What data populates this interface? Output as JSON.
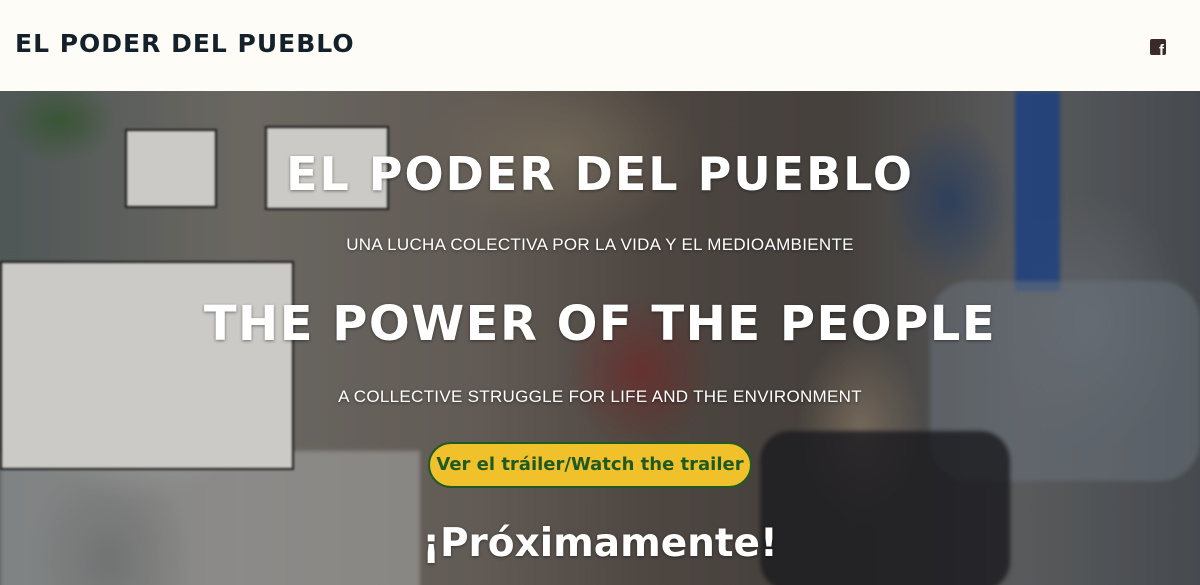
{
  "header": {
    "site_title": "EL PODER DEL PUEBLO",
    "social_icon": "facebook-icon",
    "social_glyph": "f"
  },
  "hero": {
    "title_es": "EL PODER DEL PUEBLO",
    "subtitle_es": "UNA LUCHA COLECTIVA POR LA VIDA Y EL MEDIOAMBIENTE",
    "title_en": "THE POWER OF THE PEOPLE",
    "subtitle_en": "A COLLECTIVE STRUGGLE FOR LIFE AND THE ENVIRONMENT",
    "cta_label": "Ver el tráiler/Watch the trailer",
    "coming_soon": "¡Próximamente!"
  },
  "colors": {
    "header_bg": "#fdfcf7",
    "title_text": "#14212a",
    "button_bg": "#f0c12a",
    "button_text": "#1f5a25"
  }
}
